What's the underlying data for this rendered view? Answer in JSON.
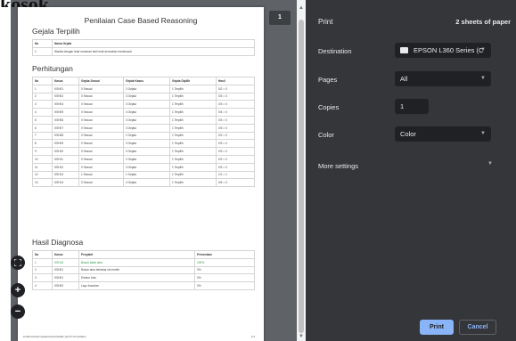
{
  "doc_top_text": "kosok",
  "preview": {
    "page_number": "1",
    "title": "Penilaian Case Based Reasoning",
    "gejala_section_title": "Gejala Terpilih",
    "gejala_table": {
      "headers": [
        "No",
        "Nama Gejala"
      ],
      "rows": [
        [
          "1",
          "Wanita dengan letar neraman teeli erak kemudian membusuk"
        ]
      ]
    },
    "perhitungan_section_title": "Perhitungan",
    "perhitungan_table": {
      "headers": [
        "No",
        "Kasus",
        "Gejala Sesuai",
        "Gejala Kasus",
        "Gejala Dipilih",
        "Hasil"
      ],
      "rows": [
        [
          "1",
          "KSH01",
          "0 Sesuai",
          "2 Gejala",
          "1 Terpilih",
          "0/2 = 0"
        ],
        [
          "2",
          "KSH02",
          "0 Sesuai",
          "3 Gejala",
          "1 Terpilih",
          "0/3 = 0"
        ],
        [
          "3",
          "KSH04",
          "0 Sesuai",
          "3 Gejala",
          "1 Terpilih",
          "0/3 = 0"
        ],
        [
          "4",
          "KSH09",
          "0 Sesuai",
          "4 Gejala",
          "1 Terpilih",
          "0/4 = 0"
        ],
        [
          "5",
          "KSH06",
          "0 Sesuai",
          "3 Gejala",
          "1 Terpilih",
          "0/3 = 0"
        ],
        [
          "6",
          "KSH07",
          "0 Sesuai",
          "3 Gejala",
          "1 Terpilih",
          "0/3 = 0"
        ],
        [
          "7",
          "KSH08",
          "0 Sesuai",
          "2 Gejala",
          "1 Terpilih",
          "0/2 = 0"
        ],
        [
          "8",
          "KSH09",
          "0 Sesuai",
          "3 Gejala",
          "1 Terpilih",
          "0/3 = 0"
        ],
        [
          "9",
          "KSH10",
          "0 Sesuai",
          "3 Gejala",
          "1 Terpilih",
          "0/3 = 0"
        ],
        [
          "10",
          "KSH11",
          "0 Sesuai",
          "2 Gejala",
          "1 Terpilih",
          "0/2 = 0"
        ],
        [
          "11",
          "KSH12",
          "0 Sesuai",
          "3 Gejala",
          "1 Terpilih",
          "0/3 = 0"
        ],
        [
          "12",
          "KSH13",
          "1 Sesuai",
          "1 Gejala",
          "1 Terpilih",
          "1/1 = 1"
        ],
        [
          "13",
          "KSH14",
          "0 Sesuai",
          "4 Gejala",
          "1 Terpilih",
          "0/4 = 0"
        ]
      ]
    },
    "hasil_section_title": "Hasil Diagnosa",
    "hasil_table": {
      "headers": [
        "No",
        "Kasus",
        "Penyakit",
        "Persentase"
      ],
      "rows": [
        [
          "1",
          "KSH13",
          "Busuk batar akar",
          "100%"
        ],
        [
          "2",
          "KSH01",
          "Busuk akar terbakar ubi meleh",
          "0%"
        ],
        [
          "3",
          "KSH01",
          "Embun bulu",
          "0%"
        ],
        [
          "4",
          "KSH02",
          "Layu fusarium",
          "0%"
        ]
      ]
    },
    "footer_left": "localhost/sistempakar/users/stable.php?n=lrmaoiklan",
    "footer_right": "1/1"
  },
  "print_panel": {
    "title": "Print",
    "sheets": "2 sheets of paper",
    "destination_label": "Destination",
    "destination_value": "EPSON L360 Series (C",
    "pages_label": "Pages",
    "pages_value": "All",
    "copies_label": "Copies",
    "copies_value": "1",
    "color_label": "Color",
    "color_value": "Color",
    "more_settings": "More settings",
    "print_button": "Print",
    "cancel_button": "Cancel"
  },
  "icons": {
    "fit": "fit-to-page-icon",
    "zoom_in": "zoom-in-icon",
    "zoom_out": "zoom-out-icon",
    "printer": "printer-icon",
    "chevron": "chevron-down-icon"
  },
  "colors": {
    "panel_bg": "#35363a",
    "field_bg": "#202124",
    "accent": "#8ab4f8",
    "preview_bg": "#5f6368",
    "highlight_text": "#2e9a4c"
  }
}
